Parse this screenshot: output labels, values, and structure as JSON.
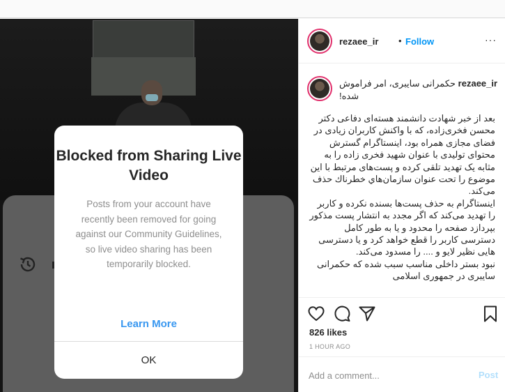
{
  "header": {
    "username": "rezaee_ir",
    "separator": "•",
    "follow_label": "Follow",
    "more_label": "···"
  },
  "media": {
    "dialog": {
      "title": "Blocked from Sharing Live Video",
      "message": "Posts from your account have recently been removed for going against our Community Guidelines, so live video sharing has been temporarily blocked.",
      "learn_more_label": "Learn More",
      "ok_label": "OK"
    },
    "sheet_icon": "history-icon"
  },
  "caption": {
    "username": "rezaee_ir",
    "headline": "حکمرانی سایبری، امر فراموش شده!",
    "body": "بعد از خبر شهادت دانشمند هسته‌ای دفاعی دکتر محسن فخری‌زاده، که با واکنش کاربران زیادی در فضای مجازی همراه بود، اینستاگرام گسترش محتوای تولیدی با عنوان شهید فخری زاده را به مثابه یک تهدید تلقی کرده و پست‌های مرتبط با این موضوع را تحت عنوان سازمان‌هاي خطرناك حذف می‌کند.\nاینستاگرام به حذف پست‌ها بسنده نکرده و کاربر را تهدید می‌کند که اگر مجدد به انتشار پست مذکور بپردازد صفحه را محدود و یا به طور کامل دسترسی کاربر را قطع خواهد کرد و یا دسترسی هایی نظیر لایو و .... را مسدود می‌کند.\nنبود بستر داخلی مناسب سبب شده که حکمرانی سایبری در جمهوری اسلامی"
  },
  "actions": {
    "icons": [
      "heart-icon",
      "comment-icon",
      "share-icon",
      "bookmark-icon"
    ],
    "likes": "826 likes",
    "time_ago": "1 HOUR AGO"
  },
  "comment": {
    "placeholder": "Add a comment...",
    "post_label": "Post"
  },
  "colors": {
    "follow": "#0095f6",
    "learn_more": "#3897f0",
    "post_disabled": "#b2dffc",
    "story_ring": "#e1306c"
  }
}
